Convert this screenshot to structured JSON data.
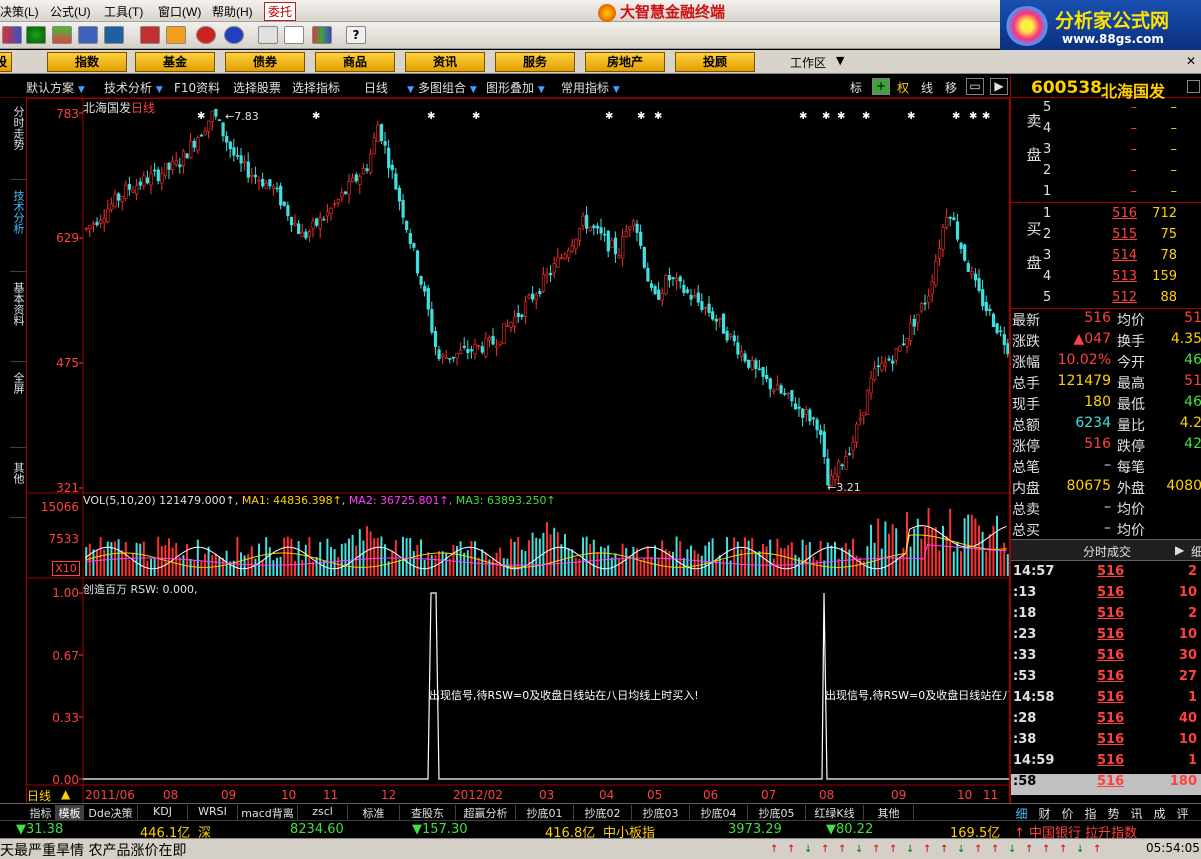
{
  "titlebar": {
    "menus": [
      "决策(L)",
      "公式(U)",
      "工具(T)",
      "窗口(W)",
      "帮助(H)"
    ],
    "active_menu": "委托",
    "brand": "大智慧金融终端"
  },
  "site": {
    "title": "分析家公式网",
    "url": "www.88gs.com"
  },
  "categories": [
    "股",
    "指数",
    "基金",
    "债券",
    "商品",
    "资讯",
    "服务",
    "房地产",
    "投顾"
  ],
  "workarea": "工作区",
  "chart_toolbar": {
    "items": [
      "默认方案",
      "技术分析",
      "F10资料",
      "选择股票",
      "选择指标",
      "日线",
      "多图组合",
      "图形叠加",
      "常用指标"
    ],
    "right_buttons": [
      "标",
      "+",
      "权",
      "线",
      "移",
      "▭",
      "▶"
    ]
  },
  "sidebar_tabs": [
    "分时走势",
    "技术分析",
    "基本资料",
    "全屏",
    "其他"
  ],
  "main_chart": {
    "stock_title": "北海国发",
    "period": "日线",
    "price_labels": [
      "783",
      "629",
      "475",
      "321"
    ],
    "high_label": "7.83",
    "low_label": "3.21"
  },
  "vol": {
    "header": "VOL(5,10,20) 121479.000↑, ",
    "ma1": "MA1: 44836.398↑,",
    "ma2": "MA2: 36725.801↑,",
    "ma3": "MA3: 63893.250↑",
    "labels": [
      "15066",
      "7533",
      "X10"
    ]
  },
  "indicator": {
    "header": "创造百万 RSW: 0.000,",
    "labels": [
      "1.00",
      "0.67",
      "0.33",
      "0.00"
    ],
    "signal_text": "出现信号,待RSW=0及收盘日线站在八日均线上时买入!",
    "signal_text_cut": "出现信号,待RSW=0及收盘日线站在八"
  },
  "date_axis": {
    "period": "日线",
    "labels": [
      "2011/06",
      "08",
      "09",
      "10",
      "11",
      "12",
      "2012/02",
      "03",
      "04",
      "05",
      "06",
      "07",
      "08",
      "09",
      "10",
      "11"
    ]
  },
  "bottom_tabs": [
    "指标",
    "模板",
    "Dde决策",
    "KDJ",
    "WRSI",
    "macd背离",
    "zscl",
    "标准",
    "查股东",
    "超赢分析",
    "抄底01",
    "抄底02",
    "抄底03",
    "抄底04",
    "抄底05",
    "红绿K线",
    "其他"
  ],
  "right_tabs": [
    "细",
    "财",
    "价",
    "指",
    "势",
    "讯",
    "成",
    "评"
  ],
  "quote": {
    "code": "600538",
    "name": "北海国发",
    "sell": [
      {
        "n": "5",
        "p": "–",
        "v": "–"
      },
      {
        "n": "4",
        "p": "–",
        "v": "–"
      },
      {
        "n": "3",
        "p": "–",
        "v": "–"
      },
      {
        "n": "2",
        "p": "–",
        "v": "–"
      },
      {
        "n": "1",
        "p": "–",
        "v": "–"
      }
    ],
    "buy": [
      {
        "n": "1",
        "p": "516",
        "v": "712"
      },
      {
        "n": "2",
        "p": "515",
        "v": "75"
      },
      {
        "n": "3",
        "p": "514",
        "p2": "",
        "v": "78"
      },
      {
        "n": "4",
        "p": "513",
        "v": "159"
      },
      {
        "n": "5",
        "p": "512",
        "v": "88"
      }
    ],
    "sell_label": "卖盘",
    "buy_label": "买盘",
    "rows": [
      {
        "l": "最新",
        "lv": "516",
        "lc": "red",
        "r": "均价",
        "rv": "51",
        "rc": "red"
      },
      {
        "l": "涨跌",
        "lv": "▲047",
        "lc": "red",
        "r": "换手",
        "rv": "4.35",
        "rc": "yel"
      },
      {
        "l": "涨幅",
        "lv": "10.02%",
        "lc": "red",
        "r": "今开",
        "rv": "46",
        "rc": "grn"
      },
      {
        "l": "总手",
        "lv": "121479",
        "lc": "yel",
        "r": "最高",
        "rv": "51",
        "rc": "red"
      },
      {
        "l": "现手",
        "lv": "180",
        "lc": "yel",
        "r": "最低",
        "rv": "46",
        "rc": "grn"
      },
      {
        "l": "总额",
        "lv": "6234",
        "lc": "cyan",
        "r": "量比",
        "rv": "4.2",
        "rc": "yel"
      },
      {
        "l": "涨停",
        "lv": "516",
        "lc": "red",
        "r": "跌停",
        "rv": "42",
        "rc": "grn"
      },
      {
        "l": "总笔",
        "lv": "–",
        "lc": "wht",
        "r": "每笔",
        "rv": "",
        "rc": "wht"
      },
      {
        "l": "内盘",
        "lv": "80675",
        "lc": "yel",
        "r": "外盘",
        "rv": "4080",
        "rc": "yel"
      },
      {
        "l": "总卖",
        "lv": "–",
        "lc": "wht",
        "r": "均价",
        "rv": "",
        "rc": "wht"
      },
      {
        "l": "总买",
        "lv": "–",
        "lc": "wht",
        "r": "均价",
        "rv": "",
        "rc": "wht"
      }
    ],
    "tick_header": "分时成交",
    "ticks": [
      {
        "t": "14:57",
        "p": "516",
        "v": "2"
      },
      {
        "t": ":13",
        "p": "516",
        "v": "10"
      },
      {
        "t": ":18",
        "p": "516",
        "v": "2"
      },
      {
        "t": ":23",
        "p": "516",
        "v": "10"
      },
      {
        "t": ":33",
        "p": "516",
        "v": "30"
      },
      {
        "t": ":53",
        "p": "516",
        "v": "27"
      },
      {
        "t": "14:58",
        "p": "516",
        "v": "1"
      },
      {
        "t": ":28",
        "p": "516",
        "v": "40"
      },
      {
        "t": ":38",
        "p": "516",
        "v": "10"
      },
      {
        "t": "14:59",
        "p": "516",
        "v": "1"
      },
      {
        "t": ":58",
        "p": "516",
        "v": "180"
      }
    ]
  },
  "ticker": {
    "items": [
      "▼31.38",
      "446.1亿",
      "深",
      "8234.60",
      "▼157.30",
      "416.8亿",
      "中小板指",
      "3973.29",
      "▼80.22",
      "169.5亿",
      "↑ 中国银行 拉升指数"
    ]
  },
  "status": {
    "text": "天最严重旱情 农产品涨价在即",
    "time": "05:54:05"
  },
  "chart_data": {
    "type": "candlestick",
    "price_range": [
      3.21,
      7.83
    ],
    "high": 7.83,
    "low": 3.21,
    "vol_range": [
      0,
      15066
    ],
    "indicator_range": [
      0,
      1
    ]
  }
}
